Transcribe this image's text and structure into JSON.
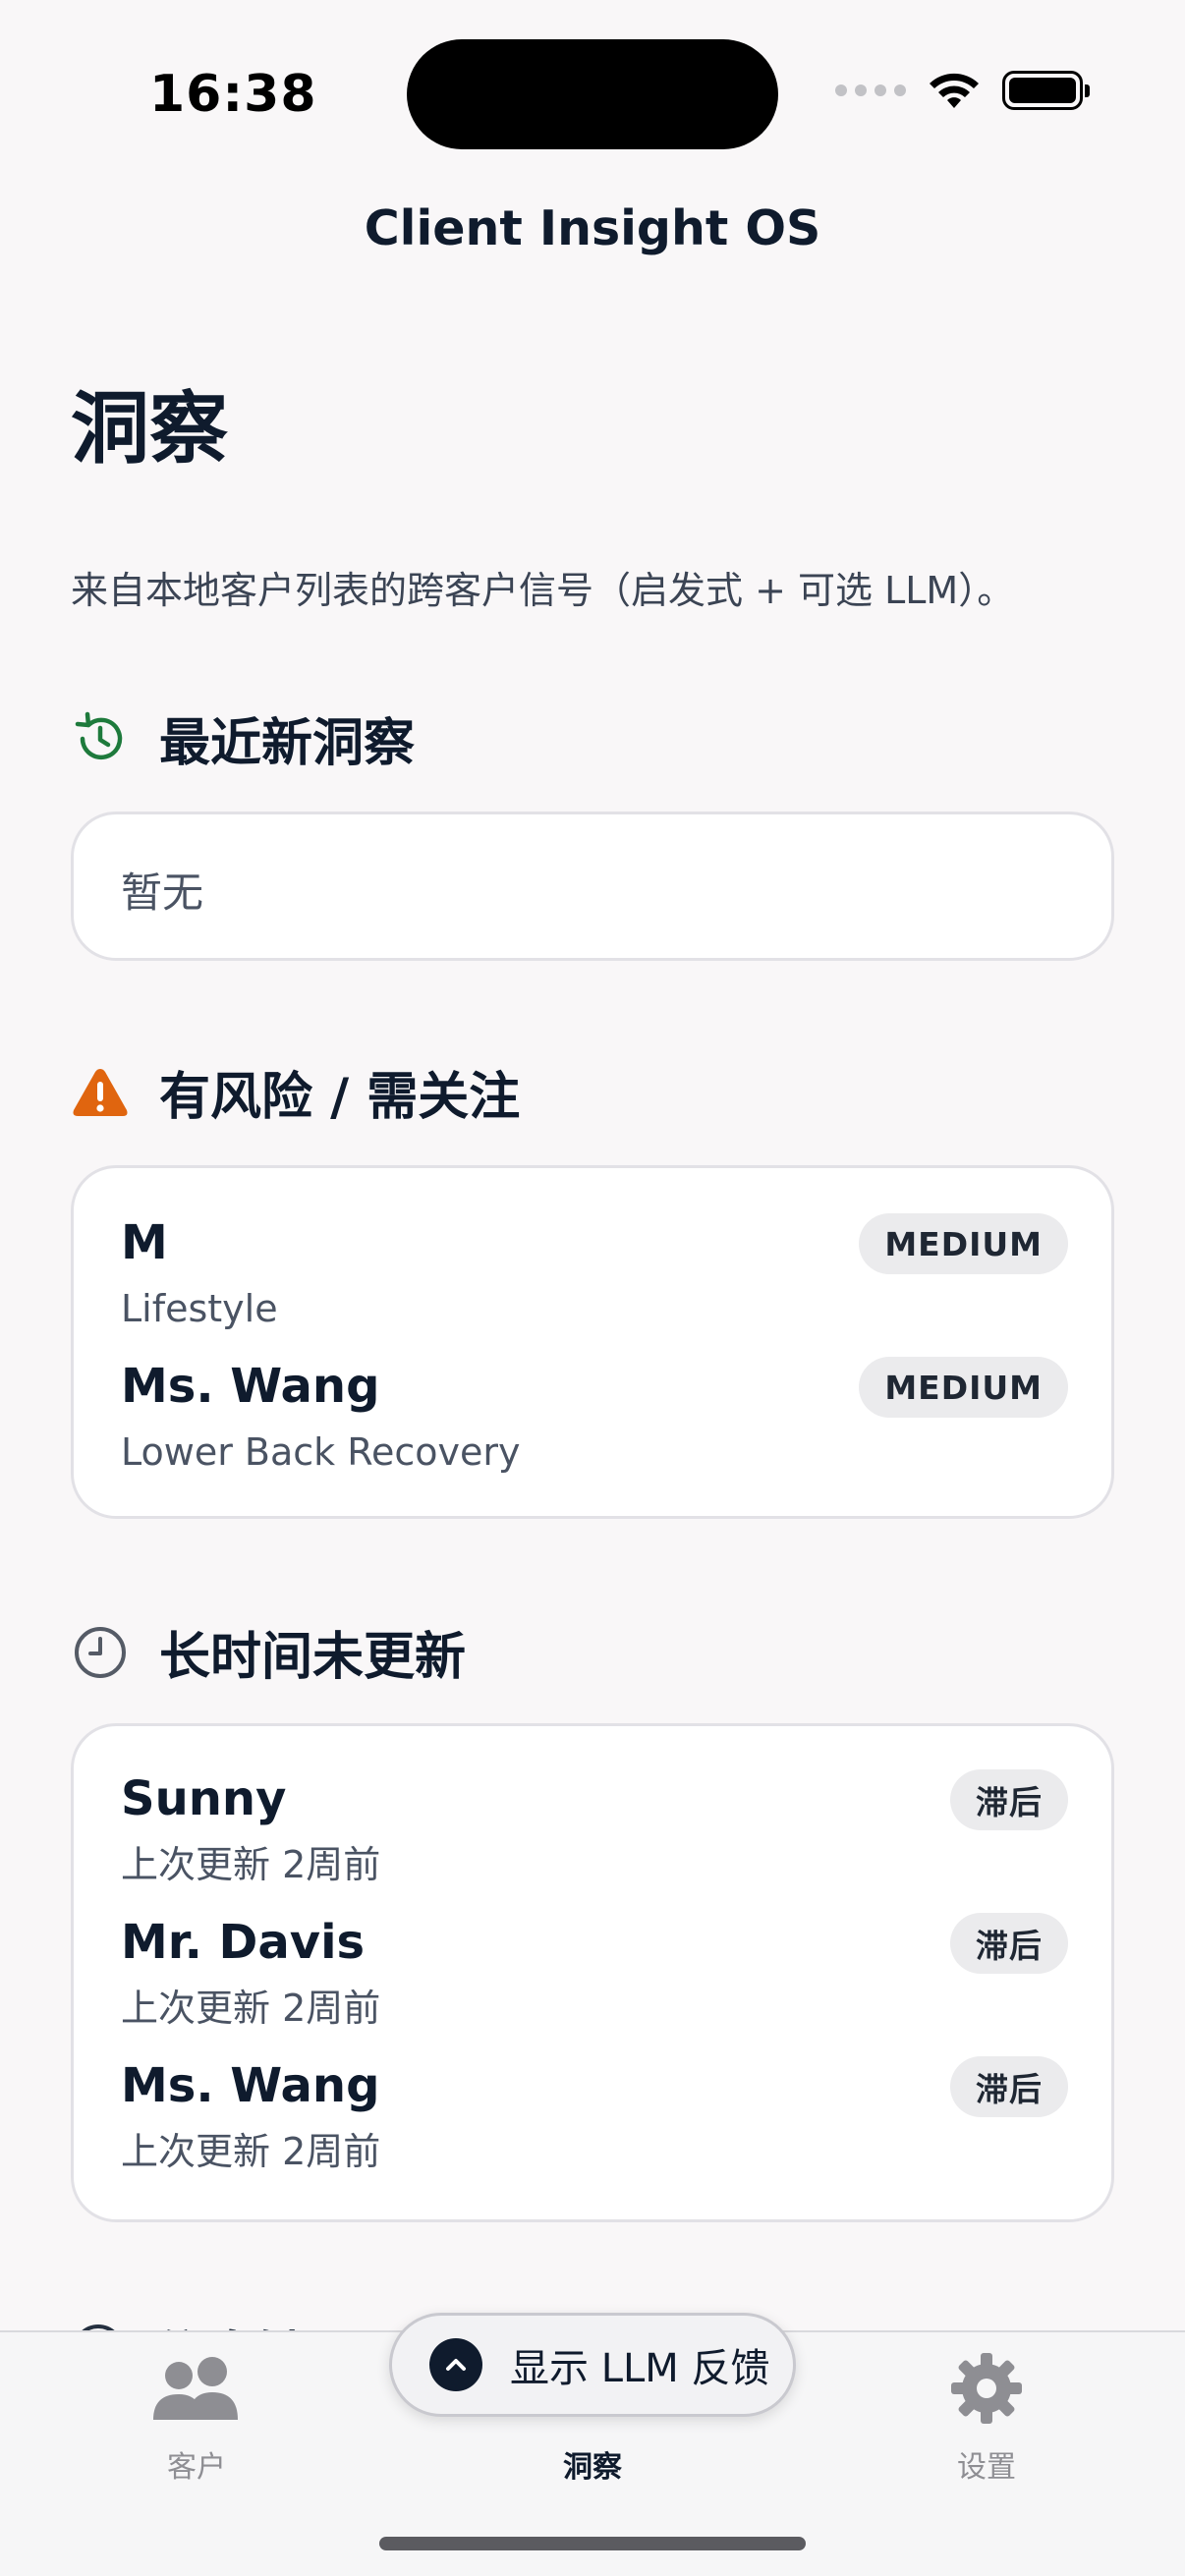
{
  "status_bar": {
    "time": "16:38"
  },
  "nav": {
    "title": "Client Insight OS"
  },
  "page": {
    "title": "洞察",
    "subtitle": "来自本地客户列表的跨客户信号（启发式 + 可选 LLM）。"
  },
  "recent": {
    "title": "最近新洞察",
    "icon": "history-icon",
    "empty_text": "暂无"
  },
  "risk": {
    "title": "有风险 / 需关注",
    "icon": "warning-icon",
    "items": [
      {
        "name": "M",
        "subtitle": "Lifestyle",
        "badge": "MEDIUM"
      },
      {
        "name": "Ms. Wang",
        "subtitle": "Lower Back Recovery",
        "badge": "MEDIUM"
      }
    ]
  },
  "stale": {
    "title": "长时间未更新",
    "icon": "clock-icon",
    "items": [
      {
        "name": "Sunny",
        "subtitle": "上次更新 2周前",
        "badge": "滞后"
      },
      {
        "name": "Mr. Davis",
        "subtitle": "上次更新 2周前",
        "badge": "滞后"
      },
      {
        "name": "Ms. Wang",
        "subtitle": "上次更新 2周前",
        "badge": "滞后"
      }
    ]
  },
  "next_section": {
    "title": "信息缺口"
  },
  "llm_toggle": {
    "label": "显示 LLM 反馈"
  },
  "tabs": [
    {
      "label": "客户",
      "icon": "people-icon",
      "active": false
    },
    {
      "label": "洞察",
      "icon": "",
      "active": true
    },
    {
      "label": "设置",
      "icon": "gear-icon",
      "active": false
    }
  ],
  "colors": {
    "accent_green": "#1e7a3c",
    "warning_orange": "#e0650f",
    "text_dark": "#0f1b2d"
  }
}
